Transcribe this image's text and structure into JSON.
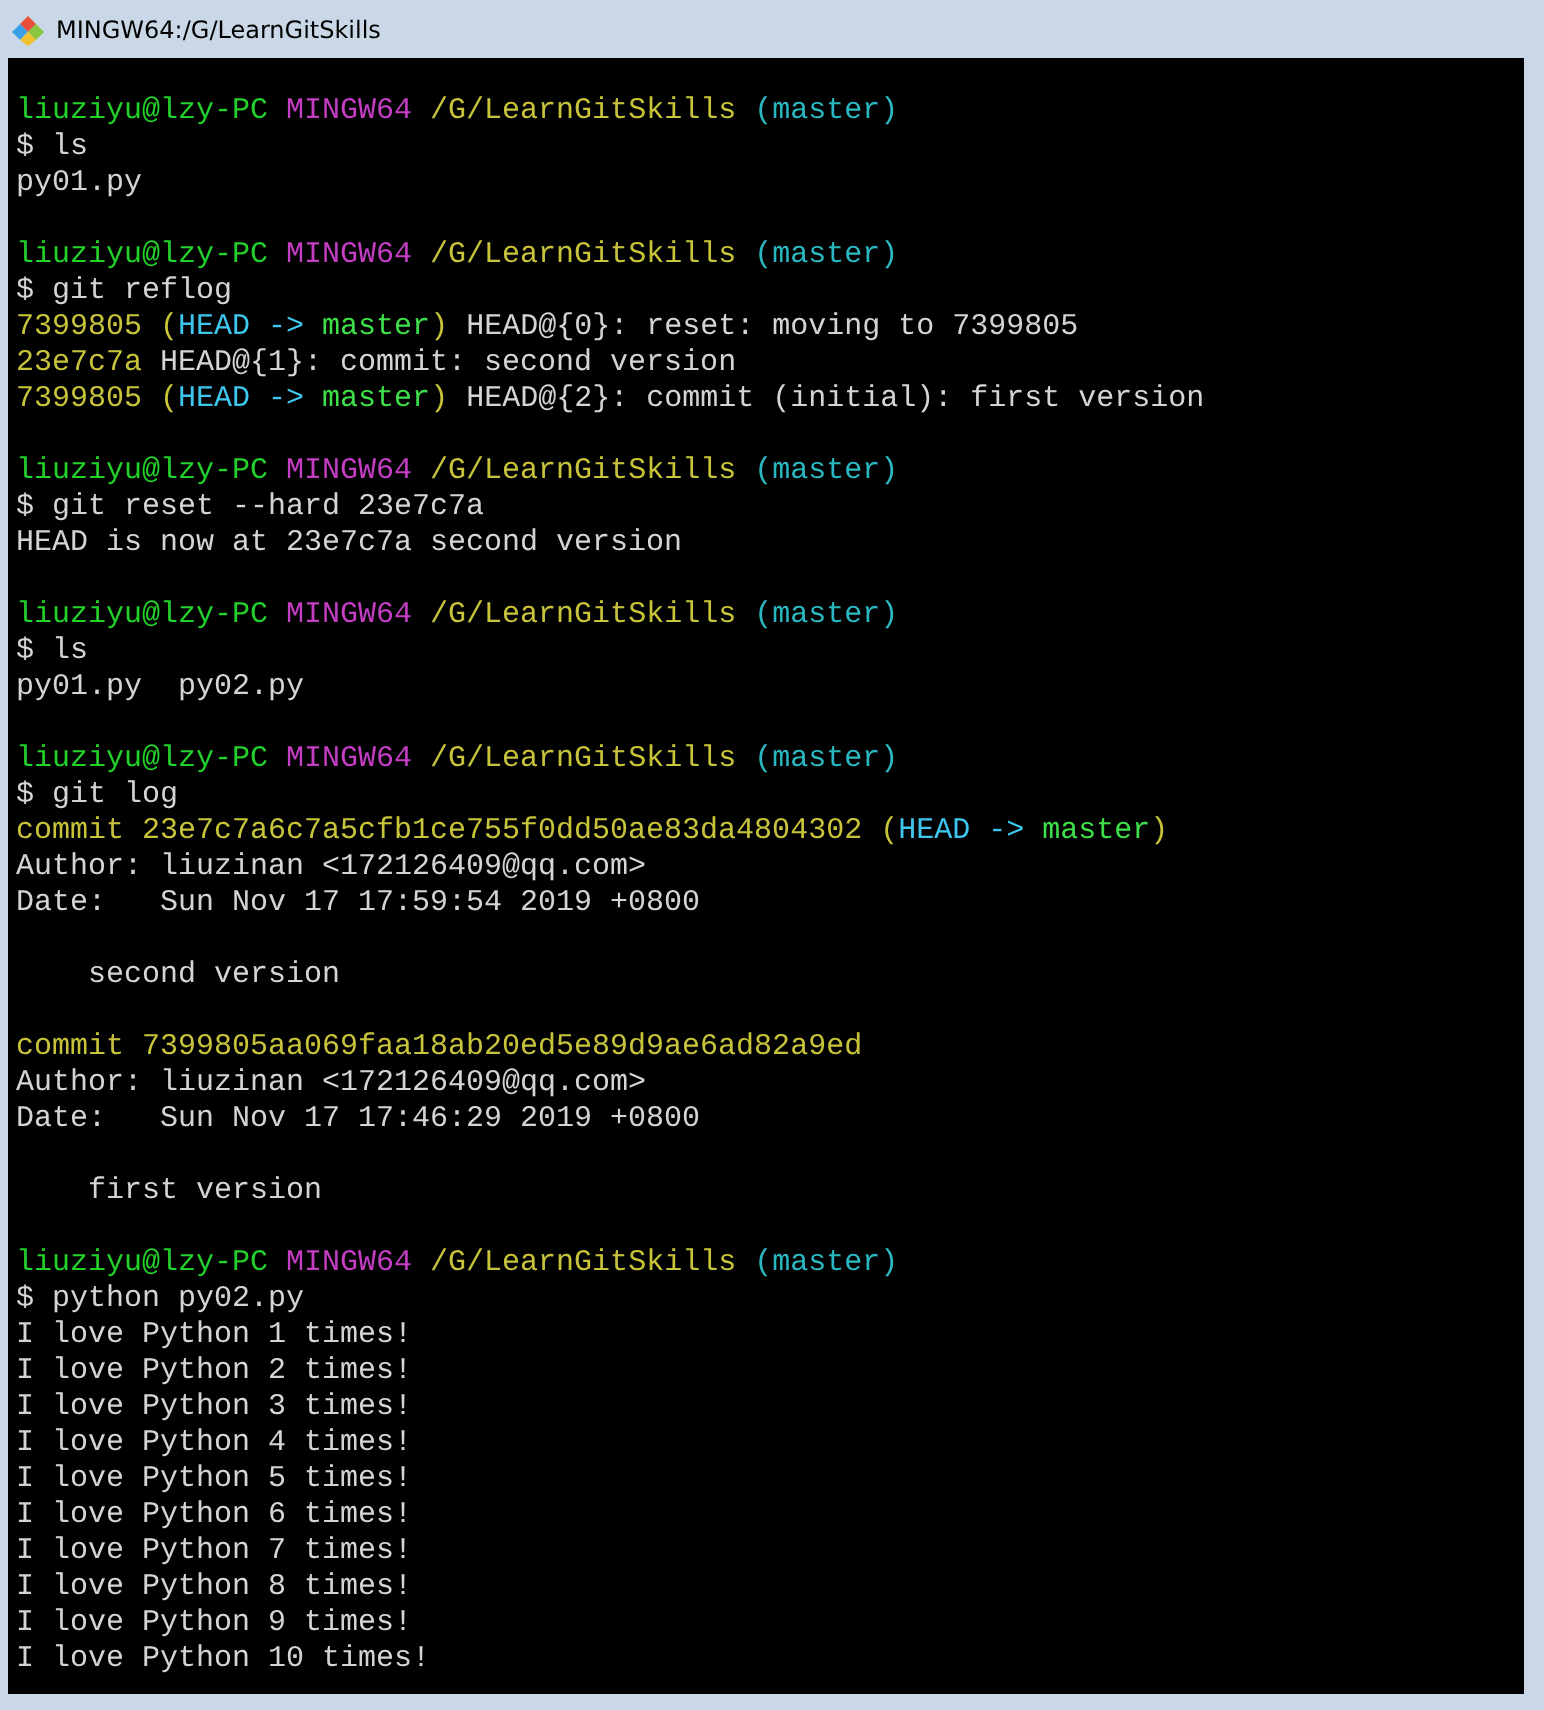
{
  "window": {
    "title": "MINGW64:/G/LearnGitSkills"
  },
  "terminal": {
    "lines": [
      {
        "kind": "blank"
      },
      {
        "kind": "text",
        "segments": [
          {
            "text": "liuziyu@lzy-PC ",
            "color": "#23d12b"
          },
          {
            "text": "MINGW64 ",
            "color": "#c43ec4"
          },
          {
            "text": "/G/LearnGitSkills ",
            "color": "#c8c43a"
          },
          {
            "text": "(master)",
            "color": "#2bb7c1"
          }
        ]
      },
      {
        "kind": "text",
        "segments": [
          {
            "text": "$ ls",
            "color": "#d4d4d4"
          }
        ]
      },
      {
        "kind": "text",
        "segments": [
          {
            "text": "py01.py",
            "color": "#d4d4d4"
          }
        ]
      },
      {
        "kind": "blank"
      },
      {
        "kind": "text",
        "segments": [
          {
            "text": "liuziyu@lzy-PC ",
            "color": "#23d12b"
          },
          {
            "text": "MINGW64 ",
            "color": "#c43ec4"
          },
          {
            "text": "/G/LearnGitSkills ",
            "color": "#c8c43a"
          },
          {
            "text": "(master)",
            "color": "#2bb7c1"
          }
        ]
      },
      {
        "kind": "text",
        "segments": [
          {
            "text": "$ git reflog",
            "color": "#d4d4d4"
          }
        ]
      },
      {
        "kind": "text",
        "segments": [
          {
            "text": "7399805 ",
            "color": "#c8c43a"
          },
          {
            "text": "(",
            "color": "#c8c43a"
          },
          {
            "text": "HEAD -> ",
            "color": "#3fc6ef"
          },
          {
            "text": "master",
            "color": "#3ee04a"
          },
          {
            "text": ")",
            "color": "#c8c43a"
          },
          {
            "text": " HEAD@{0}: reset: moving to 7399805",
            "color": "#d4d4d4"
          }
        ]
      },
      {
        "kind": "text",
        "segments": [
          {
            "text": "23e7c7a",
            "color": "#c8c43a"
          },
          {
            "text": " HEAD@{1}: commit: second version",
            "color": "#d4d4d4"
          }
        ]
      },
      {
        "kind": "text",
        "segments": [
          {
            "text": "7399805 ",
            "color": "#c8c43a"
          },
          {
            "text": "(",
            "color": "#c8c43a"
          },
          {
            "text": "HEAD -> ",
            "color": "#3fc6ef"
          },
          {
            "text": "master",
            "color": "#3ee04a"
          },
          {
            "text": ")",
            "color": "#c8c43a"
          },
          {
            "text": " HEAD@{2}: commit (initial): first version",
            "color": "#d4d4d4"
          }
        ]
      },
      {
        "kind": "blank"
      },
      {
        "kind": "text",
        "segments": [
          {
            "text": "liuziyu@lzy-PC ",
            "color": "#23d12b"
          },
          {
            "text": "MINGW64 ",
            "color": "#c43ec4"
          },
          {
            "text": "/G/LearnGitSkills ",
            "color": "#c8c43a"
          },
          {
            "text": "(master)",
            "color": "#2bb7c1"
          }
        ]
      },
      {
        "kind": "text",
        "segments": [
          {
            "text": "$ git reset --hard 23e7c7a",
            "color": "#d4d4d4"
          }
        ]
      },
      {
        "kind": "text",
        "segments": [
          {
            "text": "HEAD is now at 23e7c7a second version",
            "color": "#d4d4d4"
          }
        ]
      },
      {
        "kind": "blank"
      },
      {
        "kind": "text",
        "segments": [
          {
            "text": "liuziyu@lzy-PC ",
            "color": "#23d12b"
          },
          {
            "text": "MINGW64 ",
            "color": "#c43ec4"
          },
          {
            "text": "/G/LearnGitSkills ",
            "color": "#c8c43a"
          },
          {
            "text": "(master)",
            "color": "#2bb7c1"
          }
        ]
      },
      {
        "kind": "text",
        "segments": [
          {
            "text": "$ ls",
            "color": "#d4d4d4"
          }
        ]
      },
      {
        "kind": "text",
        "segments": [
          {
            "text": "py01.py  py02.py",
            "color": "#d4d4d4"
          }
        ]
      },
      {
        "kind": "blank"
      },
      {
        "kind": "text",
        "segments": [
          {
            "text": "liuziyu@lzy-PC ",
            "color": "#23d12b"
          },
          {
            "text": "MINGW64 ",
            "color": "#c43ec4"
          },
          {
            "text": "/G/LearnGitSkills ",
            "color": "#c8c43a"
          },
          {
            "text": "(master)",
            "color": "#2bb7c1"
          }
        ]
      },
      {
        "kind": "text",
        "segments": [
          {
            "text": "$ git log",
            "color": "#d4d4d4"
          }
        ]
      },
      {
        "kind": "text",
        "segments": [
          {
            "text": "commit 23e7c7a6c7a5cfb1ce755f0dd50ae83da4804302 ",
            "color": "#c8c43a"
          },
          {
            "text": "(",
            "color": "#c8c43a"
          },
          {
            "text": "HEAD -> ",
            "color": "#3fc6ef"
          },
          {
            "text": "master",
            "color": "#3ee04a"
          },
          {
            "text": ")",
            "color": "#c8c43a"
          }
        ]
      },
      {
        "kind": "text",
        "segments": [
          {
            "text": "Author: liuzinan <172126409@qq.com>",
            "color": "#d4d4d4"
          }
        ]
      },
      {
        "kind": "text",
        "segments": [
          {
            "text": "Date:   Sun Nov 17 17:59:54 2019 +0800",
            "color": "#d4d4d4"
          }
        ]
      },
      {
        "kind": "blank"
      },
      {
        "kind": "text",
        "segments": [
          {
            "text": "    second version",
            "color": "#d4d4d4"
          }
        ]
      },
      {
        "kind": "blank"
      },
      {
        "kind": "text",
        "segments": [
          {
            "text": "commit 7399805aa069faa18ab20ed5e89d9ae6ad82a9ed",
            "color": "#c8c43a"
          }
        ]
      },
      {
        "kind": "text",
        "segments": [
          {
            "text": "Author: liuzinan <172126409@qq.com>",
            "color": "#d4d4d4"
          }
        ]
      },
      {
        "kind": "text",
        "segments": [
          {
            "text": "Date:   Sun Nov 17 17:46:29 2019 +0800",
            "color": "#d4d4d4"
          }
        ]
      },
      {
        "kind": "blank"
      },
      {
        "kind": "text",
        "segments": [
          {
            "text": "    first version",
            "color": "#d4d4d4"
          }
        ]
      },
      {
        "kind": "blank"
      },
      {
        "kind": "text",
        "segments": [
          {
            "text": "liuziyu@lzy-PC ",
            "color": "#23d12b"
          },
          {
            "text": "MINGW64 ",
            "color": "#c43ec4"
          },
          {
            "text": "/G/LearnGitSkills ",
            "color": "#c8c43a"
          },
          {
            "text": "(master)",
            "color": "#2bb7c1"
          }
        ]
      },
      {
        "kind": "text",
        "segments": [
          {
            "text": "$ python py02.py",
            "color": "#d4d4d4"
          }
        ]
      },
      {
        "kind": "text",
        "segments": [
          {
            "text": "I love Python 1 times!",
            "color": "#d4d4d4"
          }
        ]
      },
      {
        "kind": "text",
        "segments": [
          {
            "text": "I love Python 2 times!",
            "color": "#d4d4d4"
          }
        ]
      },
      {
        "kind": "text",
        "segments": [
          {
            "text": "I love Python 3 times!",
            "color": "#d4d4d4"
          }
        ]
      },
      {
        "kind": "text",
        "segments": [
          {
            "text": "I love Python 4 times!",
            "color": "#d4d4d4"
          }
        ]
      },
      {
        "kind": "text",
        "segments": [
          {
            "text": "I love Python 5 times!",
            "color": "#d4d4d4"
          }
        ]
      },
      {
        "kind": "text",
        "segments": [
          {
            "text": "I love Python 6 times!",
            "color": "#d4d4d4"
          }
        ]
      },
      {
        "kind": "text",
        "segments": [
          {
            "text": "I love Python 7 times!",
            "color": "#d4d4d4"
          }
        ]
      },
      {
        "kind": "text",
        "segments": [
          {
            "text": "I love Python 8 times!",
            "color": "#d4d4d4"
          }
        ]
      },
      {
        "kind": "text",
        "segments": [
          {
            "text": "I love Python 9 times!",
            "color": "#d4d4d4"
          }
        ]
      },
      {
        "kind": "text",
        "segments": [
          {
            "text": "I love Python 10 times!",
            "color": "#d4d4d4"
          }
        ]
      }
    ]
  }
}
